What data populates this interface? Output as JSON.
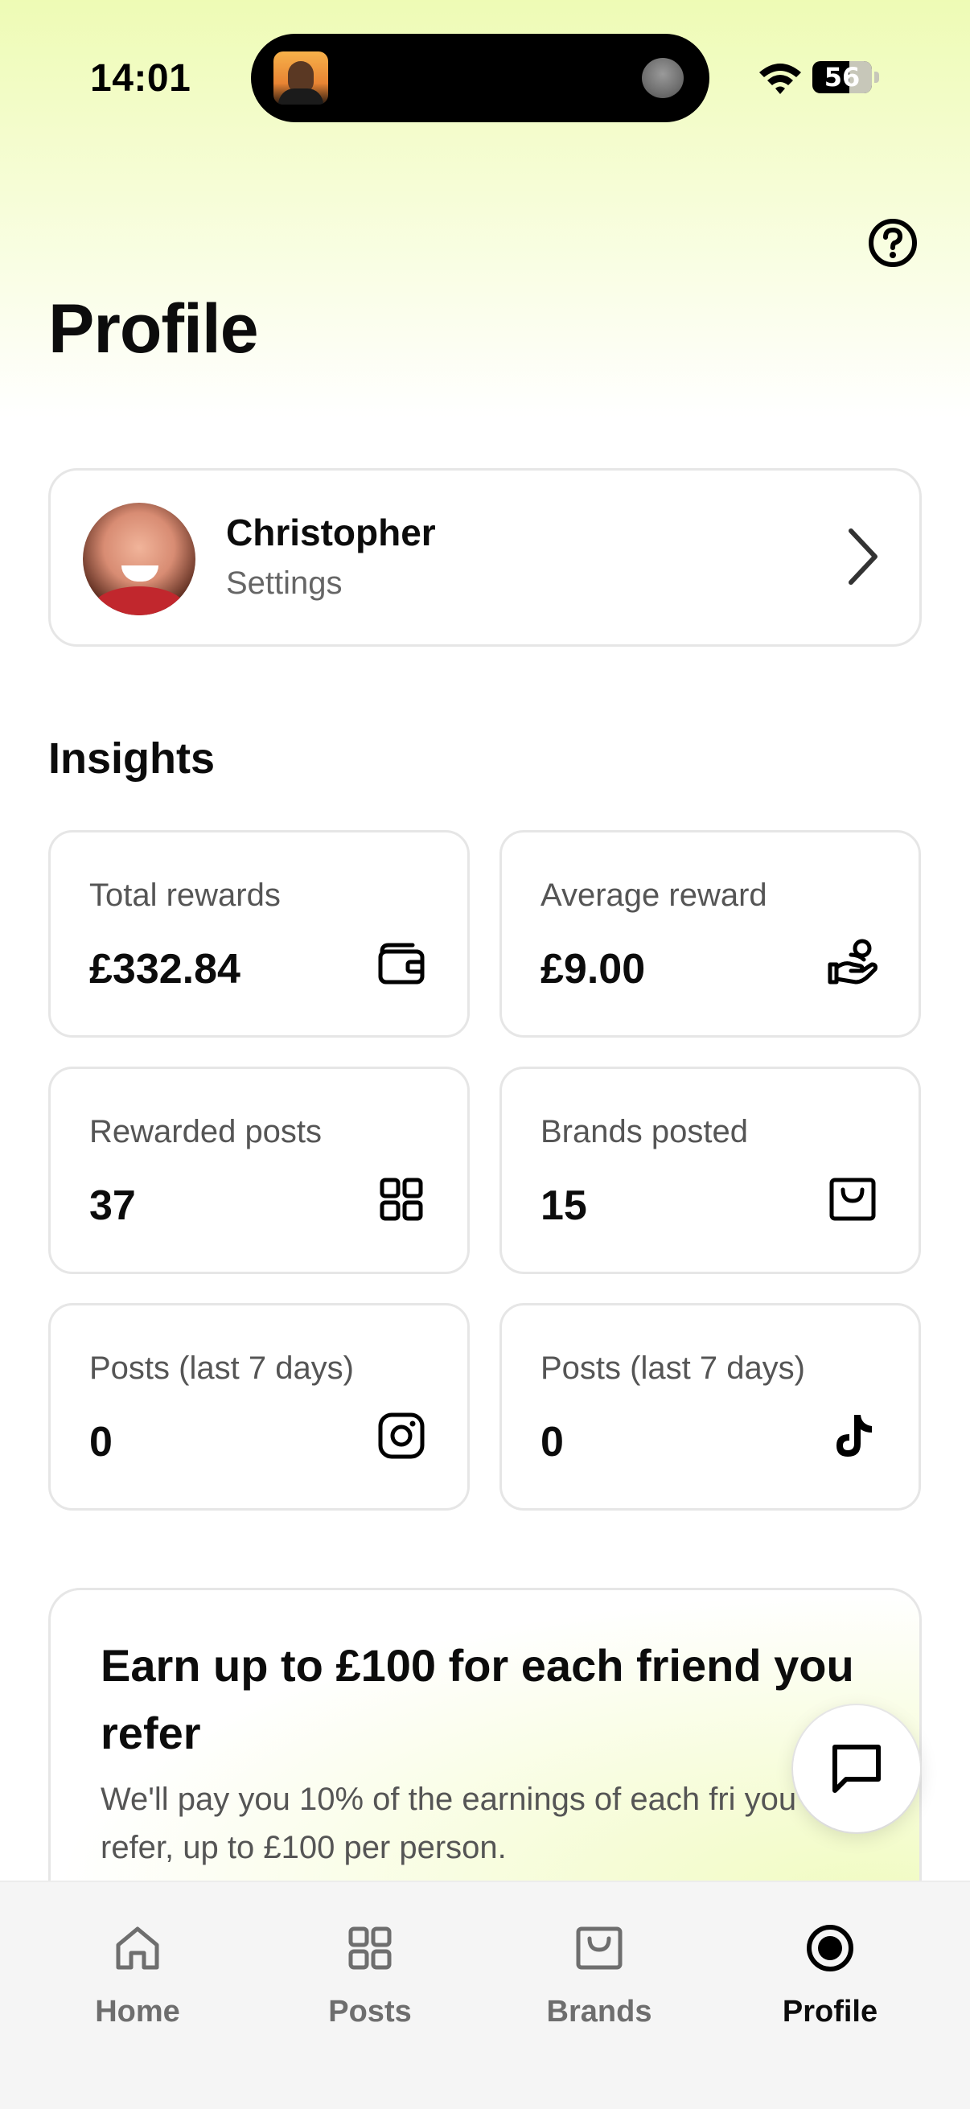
{
  "status_bar": {
    "time": "14:01",
    "battery": "56"
  },
  "header": {
    "title": "Profile",
    "help_icon": "question-circle-icon"
  },
  "profile": {
    "name": "Christopher",
    "subtitle": "Settings"
  },
  "insights": {
    "title": "Insights",
    "cards": [
      {
        "label": "Total rewards",
        "value": "£332.84",
        "icon": "wallet-icon"
      },
      {
        "label": "Average reward",
        "value": "£9.00",
        "icon": "hand-coins-icon"
      },
      {
        "label": "Rewarded posts",
        "value": "37",
        "icon": "grid-icon"
      },
      {
        "label": "Brands posted",
        "value": "15",
        "icon": "shopping-bag-icon"
      },
      {
        "label": "Posts (last 7 days)",
        "value": "0",
        "icon": "instagram-icon"
      },
      {
        "label": "Posts (last 7 days)",
        "value": "0",
        "icon": "tiktok-icon"
      }
    ]
  },
  "referral": {
    "title": "Earn up to £100 for each friend you refer",
    "body": "We'll pay you 10% of the earnings of each fri you refer, up to £100 per person."
  },
  "nav": {
    "items": [
      {
        "label": "Home",
        "icon": "home-icon"
      },
      {
        "label": "Posts",
        "icon": "grid-icon"
      },
      {
        "label": "Brands",
        "icon": "shopping-bag-icon"
      },
      {
        "label": "Profile",
        "icon": "profile-circle-icon",
        "active": true
      }
    ]
  },
  "colors": {
    "accent_gradient": "#eefbb5",
    "card_border": "#e6e6e6",
    "text_primary": "#0c0c0c",
    "text_secondary": "#666666"
  }
}
